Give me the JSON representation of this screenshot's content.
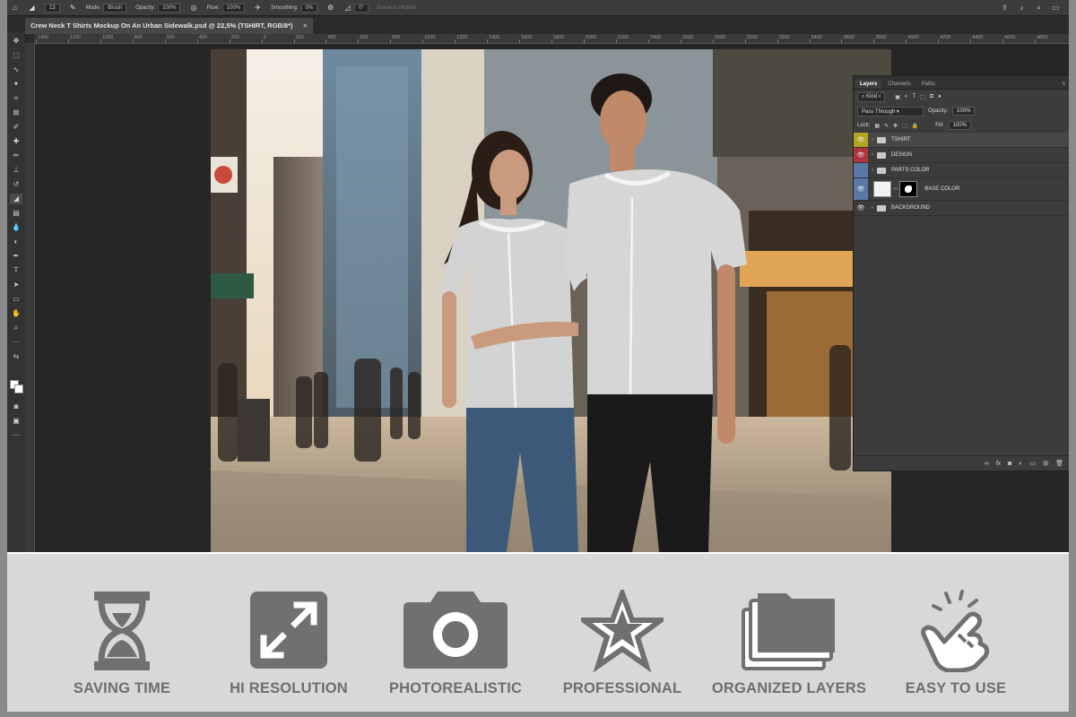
{
  "document": {
    "tab_title": "Crew Neck T Shirts Mockup On An Urban Sidewalk.psd @ 22,5% (TSHIRT, RGB/8*)",
    "close_symbol": "×"
  },
  "options_bar": {
    "size": "13",
    "mode_label": "Mode:",
    "mode_value": "Brush",
    "opacity_label": "Opacity:",
    "opacity_value": "100%",
    "flow_label": "Flow:",
    "flow_value": "100%",
    "smoothing_label": "Smoothing:",
    "smoothing_value": "0%",
    "angle_value": "0°",
    "erase_history": "Erase to History"
  },
  "ruler_labels": [
    "1400",
    "1200",
    "1000",
    "800",
    "600",
    "400",
    "200",
    "0",
    "200",
    "400",
    "600",
    "800",
    "1000",
    "1200",
    "1400",
    "1600",
    "1800",
    "2000",
    "2200",
    "2400",
    "2600",
    "2800",
    "3000",
    "3200",
    "3400",
    "3600",
    "3800",
    "4000",
    "4200",
    "4400",
    "4600",
    "4800"
  ],
  "layers_panel": {
    "tabs": [
      {
        "label": "Layers"
      },
      {
        "label": "Channels"
      },
      {
        "label": "Paths"
      }
    ],
    "filter_kind": "Kind",
    "blend_mode": "Pass Through",
    "opacity_label": "Opacity:",
    "opacity_value": "100%",
    "lock_label": "Lock:",
    "fill_label": "Fill:",
    "fill_value": "100%",
    "layers": [
      {
        "name": "TSHIRT",
        "tag_color": "#b3a51e",
        "visible": true
      },
      {
        "name": "DESIGN",
        "tag_color": "#b0343c",
        "visible": true
      },
      {
        "name": "PARTS COLOR",
        "tag_color": "#5a78a6",
        "visible": false
      },
      {
        "name": "BASE COLOR",
        "tag_color": "#5a78a6",
        "visible": true
      },
      {
        "name": "BACKGROUND",
        "tag_color": "#3c3c3c",
        "visible": true
      }
    ],
    "footer_icons": [
      "link-icon",
      "fx-icon",
      "mask-icon",
      "adjustment-icon",
      "folder-icon",
      "new-layer-icon",
      "trash-icon"
    ]
  },
  "features": [
    {
      "label": "SAVING TIME",
      "icon": "hourglass-icon"
    },
    {
      "label": "HI RESOLUTION",
      "icon": "expand-icon"
    },
    {
      "label": "PHOTOREALISTIC",
      "icon": "camera-icon"
    },
    {
      "label": "PROFESSIONAL",
      "icon": "star-icon"
    },
    {
      "label": "ORGANIZED LAYERS",
      "icon": "layers-icon"
    },
    {
      "label": "EASY TO USE",
      "icon": "hand-pointer-icon"
    }
  ],
  "colors": {
    "feature_icon": "#707070",
    "feature_background": "#d8d8d8"
  }
}
